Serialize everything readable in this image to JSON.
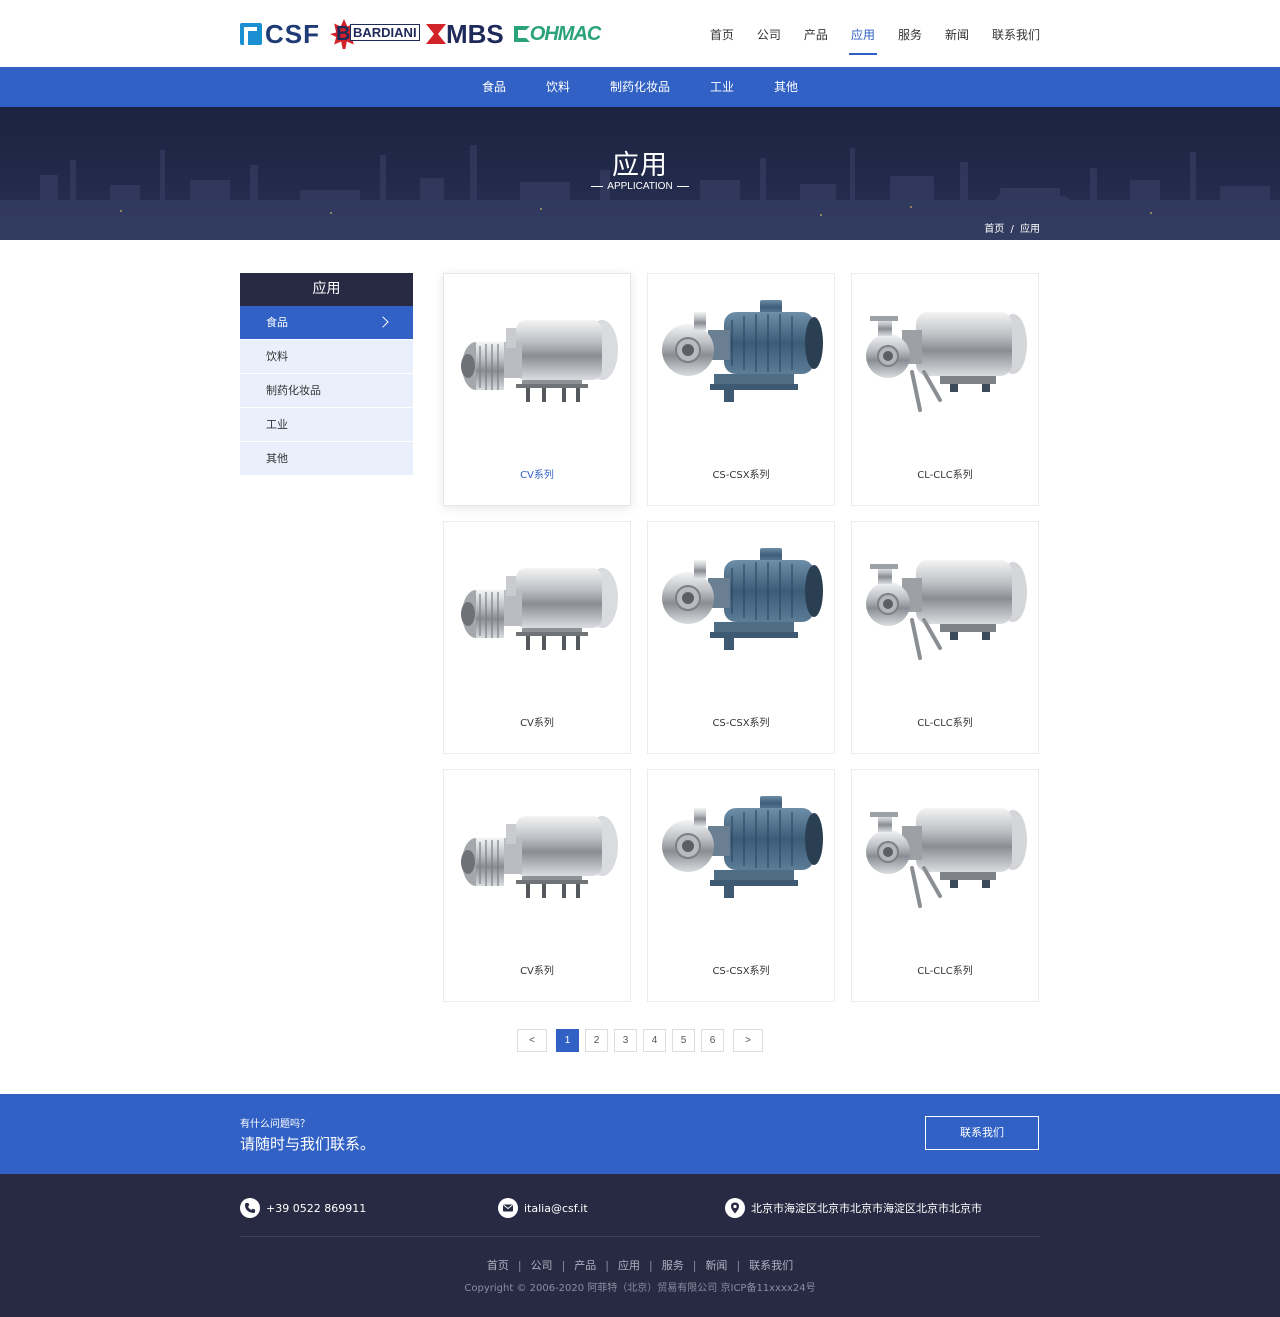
{
  "brand": {
    "logos": [
      {
        "name": "CSF"
      },
      {
        "name": "BARDIANI"
      },
      {
        "name": "MBS"
      },
      {
        "name": "OHMAC"
      }
    ]
  },
  "nav": {
    "items": [
      "首页",
      "公司",
      "产品",
      "应用",
      "服务",
      "新闻",
      "联系我们"
    ],
    "active_index": 3
  },
  "subnav": {
    "items": [
      "食品",
      "饮料",
      "制药化妆品",
      "工业",
      "其他"
    ]
  },
  "banner": {
    "title": "应用",
    "subtitle": "APPLICATION",
    "breadcrumb": {
      "home": "首页",
      "separator": "/",
      "current": "应用"
    }
  },
  "sidebar": {
    "title": "应用",
    "items": [
      "食品",
      "饮料",
      "制药化妆品",
      "工业",
      "其他"
    ],
    "active_index": 0
  },
  "products": [
    {
      "label": "CV系列",
      "kind": "cv"
    },
    {
      "label": "CS-CSX系列",
      "kind": "csx"
    },
    {
      "label": "CL-CLC系列",
      "kind": "clc"
    },
    {
      "label": "CV系列",
      "kind": "cv"
    },
    {
      "label": "CS-CSX系列",
      "kind": "csx"
    },
    {
      "label": "CL-CLC系列",
      "kind": "clc"
    },
    {
      "label": "CV系列",
      "kind": "cv"
    },
    {
      "label": "CS-CSX系列",
      "kind": "csx"
    },
    {
      "label": "CL-CLC系列",
      "kind": "clc"
    }
  ],
  "pagination": {
    "prev": "<",
    "next": ">",
    "pages": [
      "1",
      "2",
      "3",
      "4",
      "5",
      "6"
    ],
    "current": 1
  },
  "cta": {
    "question": "有什么问题吗？",
    "headline": "请随时与我们联系。",
    "button": "联系我们"
  },
  "footer": {
    "phone": "+39 0522 869911",
    "email": "italia@csf.it",
    "address": "北京市海淀区北京市北京市海淀区北京市北京市",
    "links": [
      "首页",
      "公司",
      "产品",
      "应用",
      "服务",
      "新闻",
      "联系我们"
    ],
    "copyright": "Copyright © 2006-2020 阿菲特（北京）贸易有限公司  京ICP备11xxxx24号"
  },
  "colors": {
    "primary": "#3161c4",
    "dark": "#282a43",
    "sidebar_bg": "#eaf0fb"
  }
}
